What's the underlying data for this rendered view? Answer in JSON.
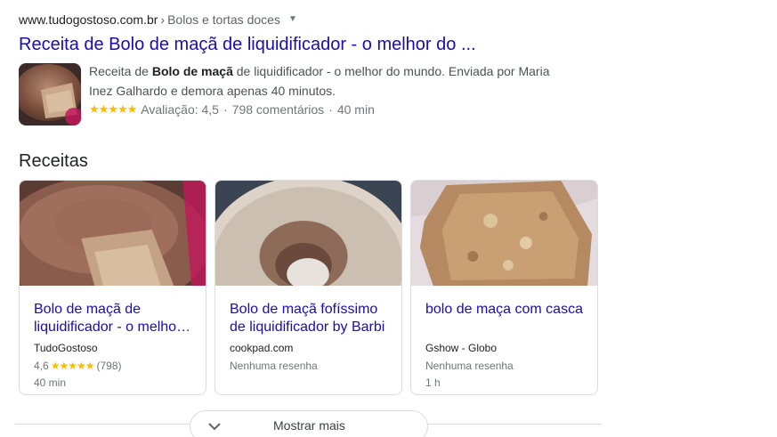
{
  "result": {
    "domain": "www.tudogostoso.com.br",
    "breadcrumb_sep": "›",
    "breadcrumb": "Bolos e tortas doces",
    "title": "Receita de Bolo de maçã de liquidificador - o melhor do ...",
    "snippet_pre": "Receita de ",
    "snippet_bold": "Bolo de maçã",
    "snippet_post": " de liquidificador - o melhor do mundo. Enviada por Maria Inez Galhardo e demora apenas 40 minutos.",
    "stars": "★★★★★",
    "rating_label": "Avaliação: 4,5",
    "reviews": "798 comentários",
    "time": "40 min",
    "separator": "·"
  },
  "section": {
    "title": "Receitas"
  },
  "cards": [
    {
      "title_line1": "Bolo de maçã de",
      "title_line2": "liquidificador - o melho…",
      "source": "TudoGostoso",
      "rating": "4,6",
      "stars": "★★★★★",
      "count": "(798)",
      "time": "40 min"
    },
    {
      "title_line1": "Bolo de maçã fofíssimo",
      "title_line2": "de liquidificador by Barbi",
      "source": "cookpad.com",
      "review": "Nenhuma resenha"
    },
    {
      "title_line1": "bolo de maça com casca",
      "title_line2": "",
      "source": "Gshow - Globo",
      "review": "Nenhuma resenha",
      "time": "1 h"
    }
  ],
  "more": {
    "label": "Mostrar mais",
    "icon": "chevron-down-icon"
  },
  "colors": {
    "link": "#1a0dab",
    "star": "#fbbc04",
    "border": "#dadce0",
    "muted": "#70757a"
  }
}
